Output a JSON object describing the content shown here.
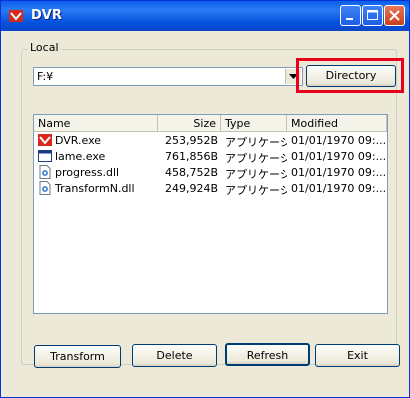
{
  "window": {
    "title": "DVR"
  },
  "group": {
    "label": "Local"
  },
  "path": {
    "value": "F:¥"
  },
  "buttons": {
    "directory": "Directory",
    "transform": "Transform",
    "delete": "Delete",
    "refresh": "Refresh",
    "exit": "Exit"
  },
  "list": {
    "columns": [
      "Name",
      "Size",
      "Type",
      "Modified"
    ],
    "rows": [
      {
        "name": "DVR.exe",
        "size": "253,952B",
        "type": "アプリケーシ...",
        "modified": "01/01/1970 09:...",
        "icon": "dvr-app-icon"
      },
      {
        "name": "lame.exe",
        "size": "761,856B",
        "type": "アプリケーシ...",
        "modified": "01/01/1970 09:...",
        "icon": "exe-file-icon"
      },
      {
        "name": "progress.dll",
        "size": "458,752B",
        "type": "アプリケーシ...",
        "modified": "01/01/1970 09:...",
        "icon": "dll-file-icon"
      },
      {
        "name": "TransformN.dll",
        "size": "249,924B",
        "type": "アプリケーシ...",
        "modified": "01/01/1970 09:...",
        "icon": "dll-file-icon"
      }
    ]
  },
  "colors": {
    "titlebar": "#0a5ee8",
    "highlight": "#e8001c",
    "window_bg": "#ece9d8"
  }
}
